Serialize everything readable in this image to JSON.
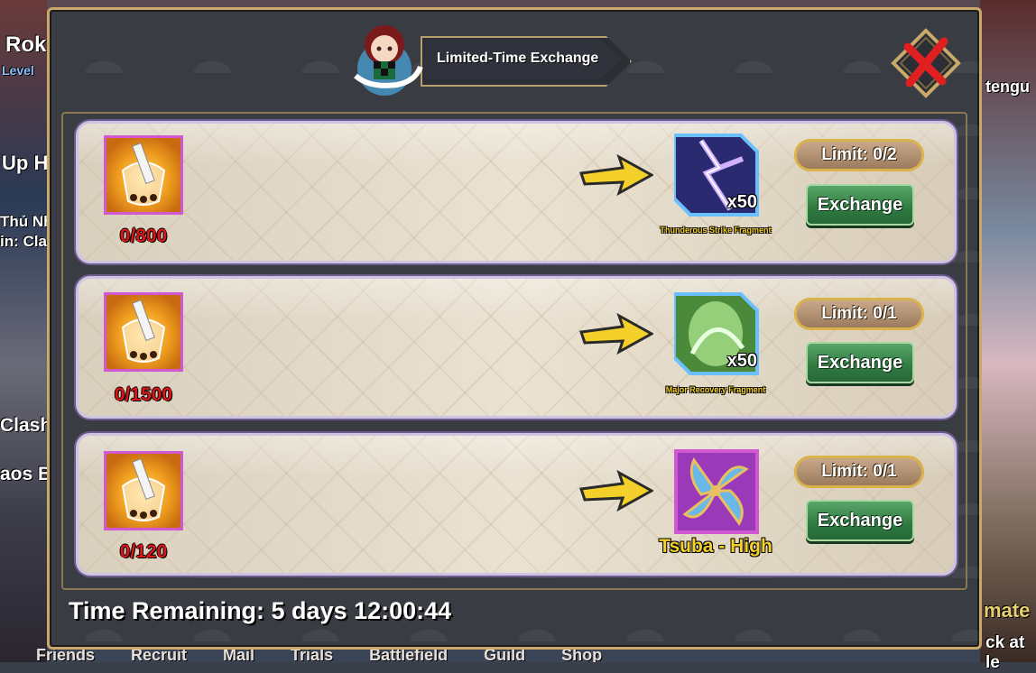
{
  "dialog": {
    "title": "Limited-Time Exchange",
    "close_icon": "close-x-icon",
    "time_remaining": "Time Remaining: 5 days 12:00:44"
  },
  "rows": [
    {
      "cost_icon": "bubble-tea-icon",
      "cost_count": "0/800",
      "reward_icon": "thunder-fragment-icon",
      "reward_qty": "x50",
      "reward_name": "Thunderous Strike Fragment",
      "limit": "Limit: 0/2",
      "button": "Exchange"
    },
    {
      "cost_icon": "bubble-tea-icon",
      "cost_count": "0/1500",
      "reward_icon": "recovery-fragment-icon",
      "reward_qty": "x50",
      "reward_name": "Major Recovery Fragment",
      "limit": "Limit: 0/1",
      "button": "Exchange"
    },
    {
      "cost_icon": "bubble-tea-icon",
      "cost_count": "0/120",
      "reward_icon": "tsuba-icon",
      "reward_qty": "",
      "reward_name": "Tsuba - High",
      "limit": "Limit: 0/1",
      "button": "Exchange"
    }
  ],
  "background": {
    "left_labels": [
      "Rok",
      "Level",
      "Up H",
      "Thủ Nh",
      "in: Cla",
      "Clash",
      "aos B"
    ],
    "right_labels": [
      "tengu",
      "mate",
      "ck at le"
    ],
    "nav": [
      "Friends",
      "Recruit",
      "Mail",
      "Trials",
      "Battlefield",
      "Guild",
      "Shop"
    ]
  },
  "colors": {
    "panel_border": "#c8a96a",
    "cost_count": "#d81818",
    "reward_name": "#f3d02a",
    "exchange_button": "#2f7a40"
  }
}
